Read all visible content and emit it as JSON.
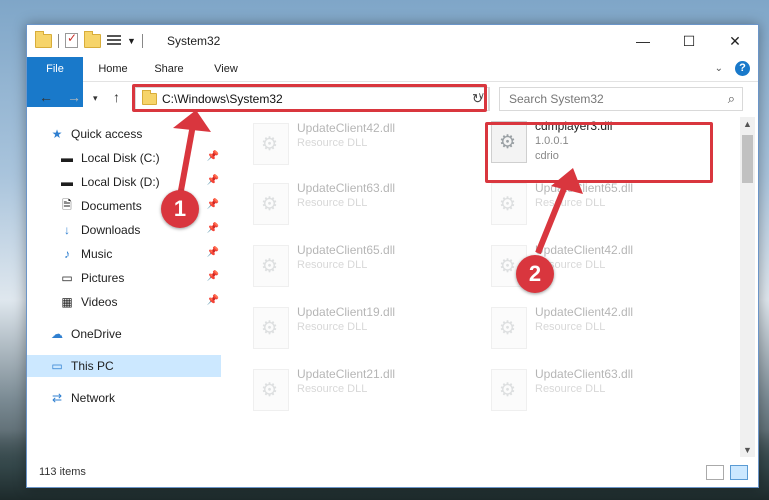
{
  "window": {
    "title": "System32",
    "controls": {
      "minimize": "—",
      "maximize": "☐",
      "close": "✕"
    }
  },
  "ribbon": {
    "tabs": [
      {
        "label": "File"
      },
      {
        "label": "Home"
      },
      {
        "label": "Share"
      },
      {
        "label": "View"
      }
    ],
    "help": "?"
  },
  "address": {
    "path": "C:\\Windows\\System32",
    "search_placeholder": "Search System32"
  },
  "sidebar": {
    "items": [
      {
        "label": "Quick access",
        "icon": "star-icon"
      },
      {
        "label": "Local Disk (C:)",
        "icon": "drive-icon",
        "pinned": true
      },
      {
        "label": "Local Disk (D:)",
        "icon": "drive-icon",
        "pinned": true
      },
      {
        "label": "Documents",
        "icon": "documents-icon",
        "pinned": true
      },
      {
        "label": "Downloads",
        "icon": "downloads-icon",
        "pinned": true
      },
      {
        "label": "Music",
        "icon": "music-icon",
        "pinned": true
      },
      {
        "label": "Pictures",
        "icon": "pictures-icon",
        "pinned": true
      },
      {
        "label": "Videos",
        "icon": "videos-icon",
        "pinned": true
      },
      {
        "label": "OneDrive",
        "icon": "cloud-icon"
      },
      {
        "label": "This PC",
        "icon": "computer-icon",
        "selected": true
      },
      {
        "label": "Network",
        "icon": "network-icon"
      }
    ]
  },
  "files": {
    "left": [
      {
        "name": "UpdateClient42.dll",
        "type": "Resource DLL"
      },
      {
        "name": "UpdateClient63.dll",
        "type": "Resource DLL"
      },
      {
        "name": "UpdateClient65.dll",
        "type": "Resource DLL"
      },
      {
        "name": "UpdateClient19.dll",
        "type": "Resource DLL"
      },
      {
        "name": "UpdateClient21.dll",
        "type": "Resource DLL"
      }
    ],
    "highlighted": {
      "name": "cdmplayer3.dll",
      "version": "1.0.0.1",
      "company": "cdrio"
    },
    "right": [
      {
        "name": "UpdateClient65.dll",
        "type": "Resource DLL"
      },
      {
        "name": "UpdateClient42.dll",
        "type": "Resource DLL"
      },
      {
        "name": "UpdateClient42.dll",
        "type": "Resource DLL"
      },
      {
        "name": "UpdateClient63.dll",
        "type": "Resource DLL"
      }
    ]
  },
  "status": {
    "items": "113 items"
  },
  "annotations": {
    "step1": "1",
    "step2": "2",
    "color": "#d9363e"
  }
}
